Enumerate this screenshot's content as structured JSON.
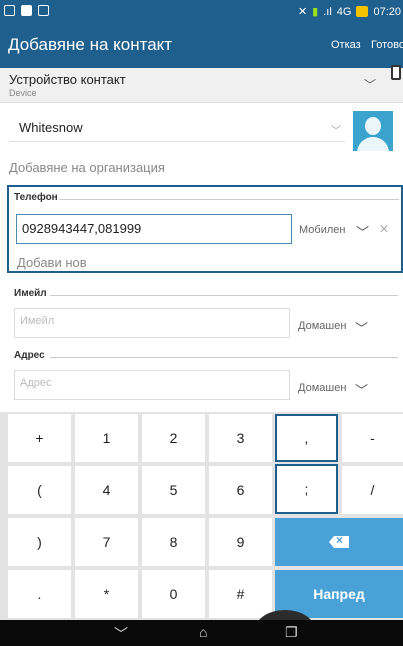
{
  "status_bar": {
    "time": "07:20",
    "signal_text": "4G",
    "icons": [
      "notification-icon",
      "mute-icon",
      "wifi-icon",
      "signal-icon",
      "battery-icon"
    ]
  },
  "app_bar": {
    "title": "Добавяне на контакт",
    "cancel_label": "Отказ",
    "done_label": "Готово"
  },
  "account": {
    "name": "Устройство контакт",
    "type": "Device"
  },
  "name_field": {
    "value": "Whitesnow"
  },
  "add_organization_label": "Добавяне на организация",
  "phone_section": {
    "label": "Телефон",
    "value": "0928943447,081999",
    "type": "Мобилен",
    "add_new_label": "Добави нов"
  },
  "email_section": {
    "label": "Имейл",
    "placeholder": "Имейл",
    "type": "Домашен"
  },
  "address_section": {
    "label": "Адрес",
    "placeholder": "Адрес",
    "type": "Домашен"
  },
  "keyboard": {
    "rows": [
      [
        "+",
        "1",
        "2",
        "3",
        ",",
        "-"
      ],
      [
        "(",
        "4",
        "5",
        "6",
        ";",
        "/"
      ],
      [
        ")",
        "7",
        "8",
        "9"
      ],
      [
        ".",
        "*",
        "0",
        "#"
      ]
    ],
    "next_label": "Напред",
    "selected_key": ","
  },
  "colors": {
    "primary": "#1f5f8d",
    "accent_key": "#4aa1d8"
  }
}
